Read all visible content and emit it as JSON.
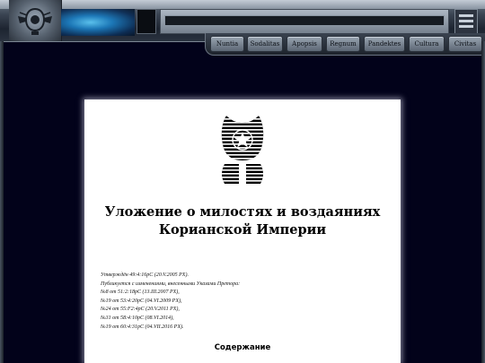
{
  "nav": {
    "items": [
      {
        "label": "Nuntia"
      },
      {
        "label": "Sodalitas"
      },
      {
        "label": "Apopsis"
      },
      {
        "label": "Regnum"
      },
      {
        "label": "Pandektes"
      },
      {
        "label": "Cultura"
      },
      {
        "label": "Civitas"
      }
    ]
  },
  "document": {
    "title_line1": "Уложение о милостях и воздаяниях",
    "title_line2": "Корианской Империи",
    "meta": [
      "Утверждён 49:4:16pC (20.V.2005 PX).",
      "Публикуется с изменениями, внесенными Указами Претора:",
      "№8 от 51:2:18pC (13.III.2007 PX),",
      "№19 от 53:4:20pC (04.VI.2009 PX),",
      "№24 от 55:F2:4pC (20.V.2011 PX),",
      "№31 от 58:4:10pC (08.VI.2014),",
      "№19 от 60:4:31pC (04.VII.2016 PX)."
    ],
    "contents_heading": "Содержание"
  },
  "icons": {
    "header_emblem": "winged-emblem-icon",
    "document_emblem": "imperial-crest-icon",
    "menu": "menu-icon"
  },
  "colors": {
    "background": "#02021a",
    "glow": "#5fd0ff"
  }
}
